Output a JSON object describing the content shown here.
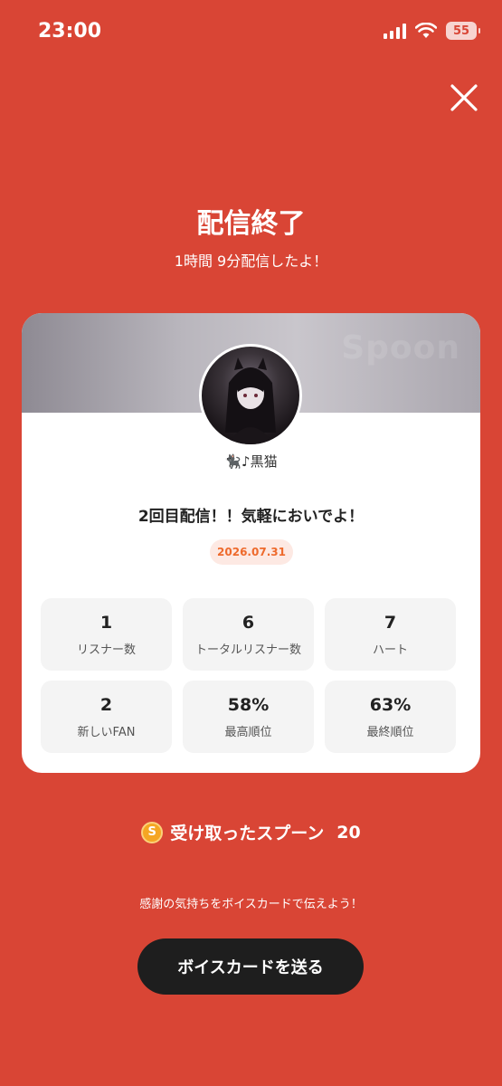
{
  "status_bar": {
    "time": "23:00",
    "battery": "55",
    "icons": [
      "signal-icon",
      "wifi-icon",
      "battery-icon"
    ]
  },
  "close_icon": "close-icon",
  "header": {
    "title": "配信終了",
    "subtitle": "1時間 9分配信したよ！"
  },
  "card": {
    "watermark": "Spoon",
    "username": "🐈‍⬛♪黒猫",
    "broadcast_title": "2回目配信！！気軽においでよ！",
    "date": "2026.07.31",
    "stats": [
      {
        "value": "1",
        "label": "リスナー数"
      },
      {
        "value": "6",
        "label": "トータルリスナー数"
      },
      {
        "value": "7",
        "label": "ハート"
      },
      {
        "value": "2",
        "label": "新しいFAN"
      },
      {
        "value": "58%",
        "label": "最高順位"
      },
      {
        "value": "63%",
        "label": "最終順位"
      }
    ]
  },
  "spoons": {
    "icon_letter": "S",
    "label": "受け取ったスプーン",
    "count": "20"
  },
  "thanks_text": "感謝の気持ちをボイスカードで伝えよう！",
  "send_button": "ボイスカードを送る",
  "colors": {
    "background": "#D94535",
    "date_badge": "#EE6A2C",
    "spoon_coin": "#F5A623",
    "button": "#1E1E1E"
  }
}
